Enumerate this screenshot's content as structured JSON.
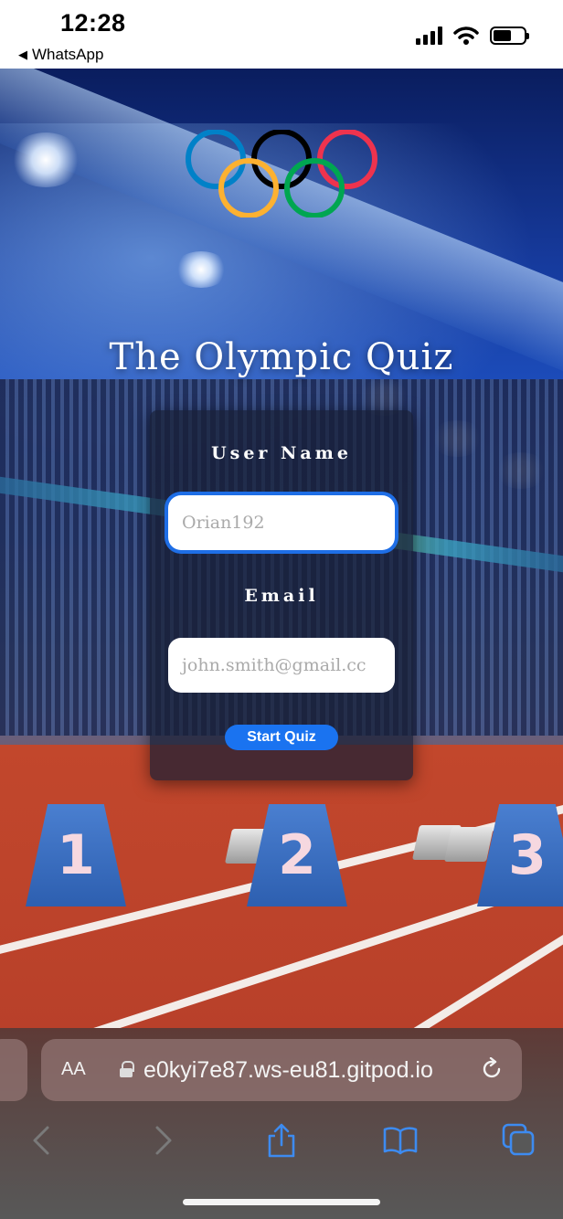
{
  "status_bar": {
    "time": "12:28",
    "back_app": "WhatsApp",
    "signal_bars": 4,
    "battery_level": 0.6
  },
  "page": {
    "title": "The Olympic Quiz",
    "logo_icon": "olympic-rings-icon"
  },
  "form": {
    "username_label": "User Name",
    "username_value": "Orian192",
    "email_label": "Email",
    "email_value": "john.smith@gmail.cc",
    "start_button": "Start Quiz"
  },
  "scene": {
    "lane_numbers": [
      "1",
      "2",
      "3"
    ]
  },
  "browser": {
    "text_size_label": "AA",
    "url": "e0kyi7e87.ws-eu81.gitpod.io",
    "toolbar_icons": [
      "back-icon",
      "forward-icon",
      "share-icon",
      "bookmarks-icon",
      "tabs-icon"
    ]
  },
  "colors": {
    "accent_blue": "#1a73f0",
    "ring_blue": "#0081c8",
    "ring_black": "#000000",
    "ring_red": "#ee334e",
    "ring_yellow": "#fcb131",
    "ring_green": "#00a651"
  }
}
